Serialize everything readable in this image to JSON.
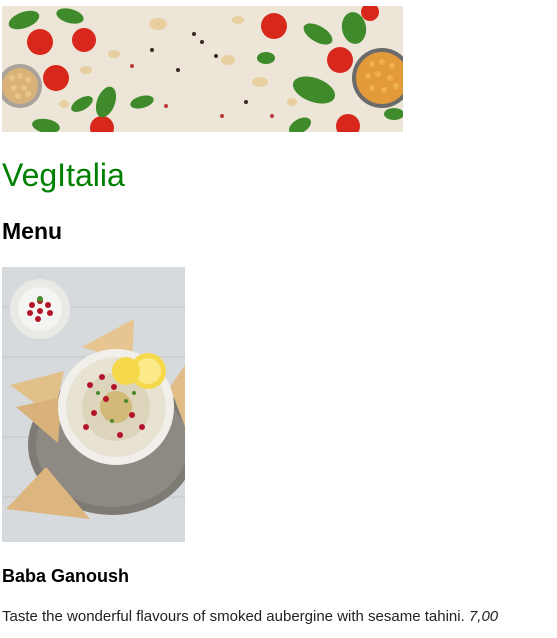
{
  "banner": {
    "alt": "Vegetables and legumes on a light background",
    "icon": "banner-image"
  },
  "site": {
    "title": "VegItalia"
  },
  "menu": {
    "heading": "Menu",
    "items": [
      {
        "image_icon": "baba-ganoush-photo",
        "name": "Baba Ganoush",
        "description": "Taste the wonderful flavours of smoked aubergine with sesame tahini.",
        "price": "7,00"
      }
    ]
  },
  "colors": {
    "title_green": "#008000",
    "text": "#222222"
  }
}
